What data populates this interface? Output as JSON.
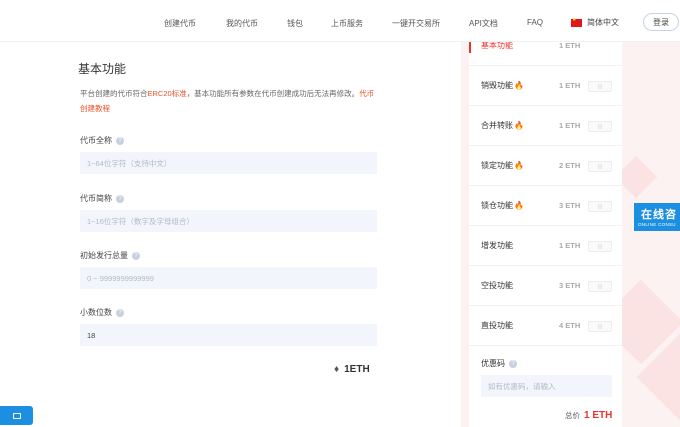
{
  "nav": {
    "items": [
      "创建代币",
      "我的代币",
      "钱包",
      "上币服务",
      "一键开交易所",
      "API文档",
      "FAQ"
    ],
    "language": "简体中文",
    "login": "登录"
  },
  "basic": {
    "title": "基本功能",
    "desc_before": "平台创建的代币符合",
    "desc_highlight": "ERC20标准",
    "desc_after": "，基本功能所有参数在代币创建成功后无法再修改。",
    "desc_link": "代币创建教程"
  },
  "form": {
    "fields": [
      {
        "label": "代币全称",
        "placeholder": "1~64位字符（支持中文）",
        "value": ""
      },
      {
        "label": "代币简称",
        "placeholder": "1~16位字符（数字及字母组合）",
        "value": ""
      },
      {
        "label": "初始发行总量",
        "placeholder": "0 ~ 9999999999999",
        "value": ""
      },
      {
        "label": "小数位数",
        "placeholder": "",
        "value": "18"
      }
    ],
    "help_icon": "question-circle-icon",
    "eth_icon": "ethereum-icon",
    "eth_total": "1ETH"
  },
  "features": [
    {
      "name": "基本功能",
      "fire": false,
      "price": "1 ETH",
      "active": true
    },
    {
      "name": "销毁功能",
      "fire": true,
      "price": "1 ETH",
      "active": false
    },
    {
      "name": "合并转账",
      "fire": true,
      "price": "1 ETH",
      "active": false
    },
    {
      "name": "锁定功能",
      "fire": true,
      "price": "2 ETH",
      "active": false
    },
    {
      "name": "锁仓功能",
      "fire": true,
      "price": "3 ETH",
      "active": false
    },
    {
      "name": "增发功能",
      "fire": false,
      "price": "1 ETH",
      "active": false
    },
    {
      "name": "空投功能",
      "fire": false,
      "price": "3 ETH",
      "active": false
    },
    {
      "name": "直投功能",
      "fire": false,
      "price": "4 ETH",
      "active": false
    }
  ],
  "coupon": {
    "label": "优惠码",
    "placeholder": "如有优惠码，请输入"
  },
  "total": {
    "label": "总价",
    "value": "1 ETH"
  },
  "online": {
    "title": "在线咨",
    "sub": "ONLINE CONSU"
  },
  "colors": {
    "accent": "#e8342e",
    "link": "#e8542b",
    "widget_blue": "#1d8fe0",
    "input_bg": "#f2f5fb"
  }
}
